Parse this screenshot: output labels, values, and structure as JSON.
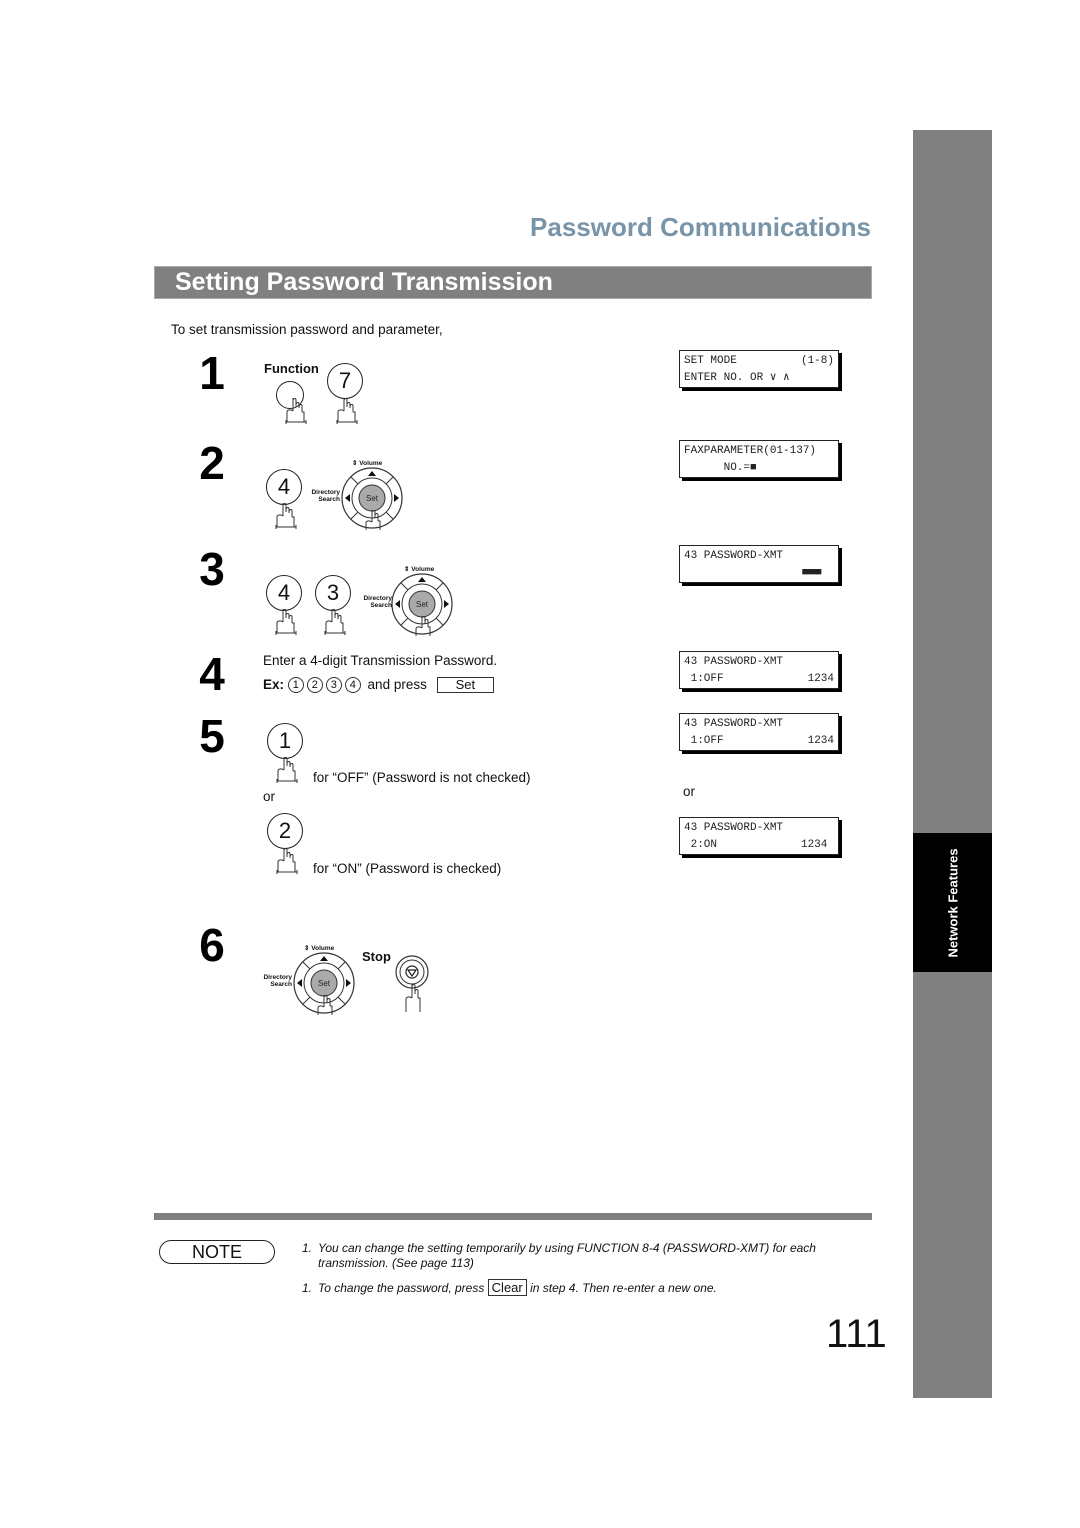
{
  "section_title": "Password Communications",
  "header_title": "Setting Password Transmission",
  "intro": "To set transmission password and parameter,",
  "side_tab": "Network Features",
  "steps": [
    {
      "number": "1",
      "keys": [
        {
          "label": "",
          "caption": "Function"
        },
        {
          "label": "7"
        }
      ]
    },
    {
      "number": "2",
      "keys": [
        {
          "label": "4"
        }
      ],
      "dpad": {
        "center": "Set",
        "up": "Volume",
        "left": "Directory Search"
      }
    },
    {
      "number": "3",
      "keys": [
        {
          "label": "4"
        },
        {
          "label": "3"
        }
      ],
      "dpad": {
        "center": "Set",
        "up": "Volume",
        "left": "Directory Search"
      }
    },
    {
      "number": "4",
      "text": "Enter a 4-digit Transmission Password.",
      "ex_label": "Ex:",
      "ex_digits": [
        "1",
        "2",
        "3",
        "4"
      ],
      "and_press": "and press",
      "set_button": "Set"
    },
    {
      "number": "5",
      "option1_key": "1",
      "option1_text": "for “OFF” (Password is not checked)",
      "or": "or",
      "option2_key": "2",
      "option2_text": "for “ON” (Password is checked)"
    },
    {
      "number": "6",
      "dpad": {
        "center": "Set",
        "up": "Volume",
        "left": "Directory Search"
      },
      "stop_label": "Stop"
    }
  ],
  "lcd_displays": [
    {
      "line1_left": "SET MODE",
      "line1_right": "(1-8)",
      "line2_left": "ENTER NO. OR ∨ ∧",
      "line2_right": ""
    },
    {
      "line1_left": "FAXPARAMETER(01-137)",
      "line1_right": "",
      "line2_left": "      NO.=■",
      "line2_right": ""
    },
    {
      "line1_left": "43 PASSWORD-XMT",
      "line1_right": "",
      "line2_left": "",
      "line2_right": "■■■■"
    },
    {
      "line1_left": "43 PASSWORD-XMT",
      "line1_right": "",
      "line2_left": " 1:OFF",
      "line2_right": "1234"
    },
    {
      "line1_left": "43 PASSWORD-XMT",
      "line1_right": "",
      "line2_left": " 1:OFF",
      "line2_right": "1234"
    },
    {
      "line1_left": "43 PASSWORD-XMT",
      "line1_right": "",
      "line2_left": " 2:ON",
      "line2_right": "1234 "
    }
  ],
  "lcd_or": "or",
  "note": {
    "label": "NOTE",
    "items": [
      {
        "num": "1.",
        "text": "You can change the setting temporarily by using FUNCTION 8-4 (PASSWORD-XMT) for each",
        "text2": "transmission. (See page 113)"
      },
      {
        "num": "1.",
        "pre": "To change the password, press",
        "button": "Clear",
        "post": "in step 4. Then re-enter a new one."
      }
    ]
  },
  "page_number": "111"
}
